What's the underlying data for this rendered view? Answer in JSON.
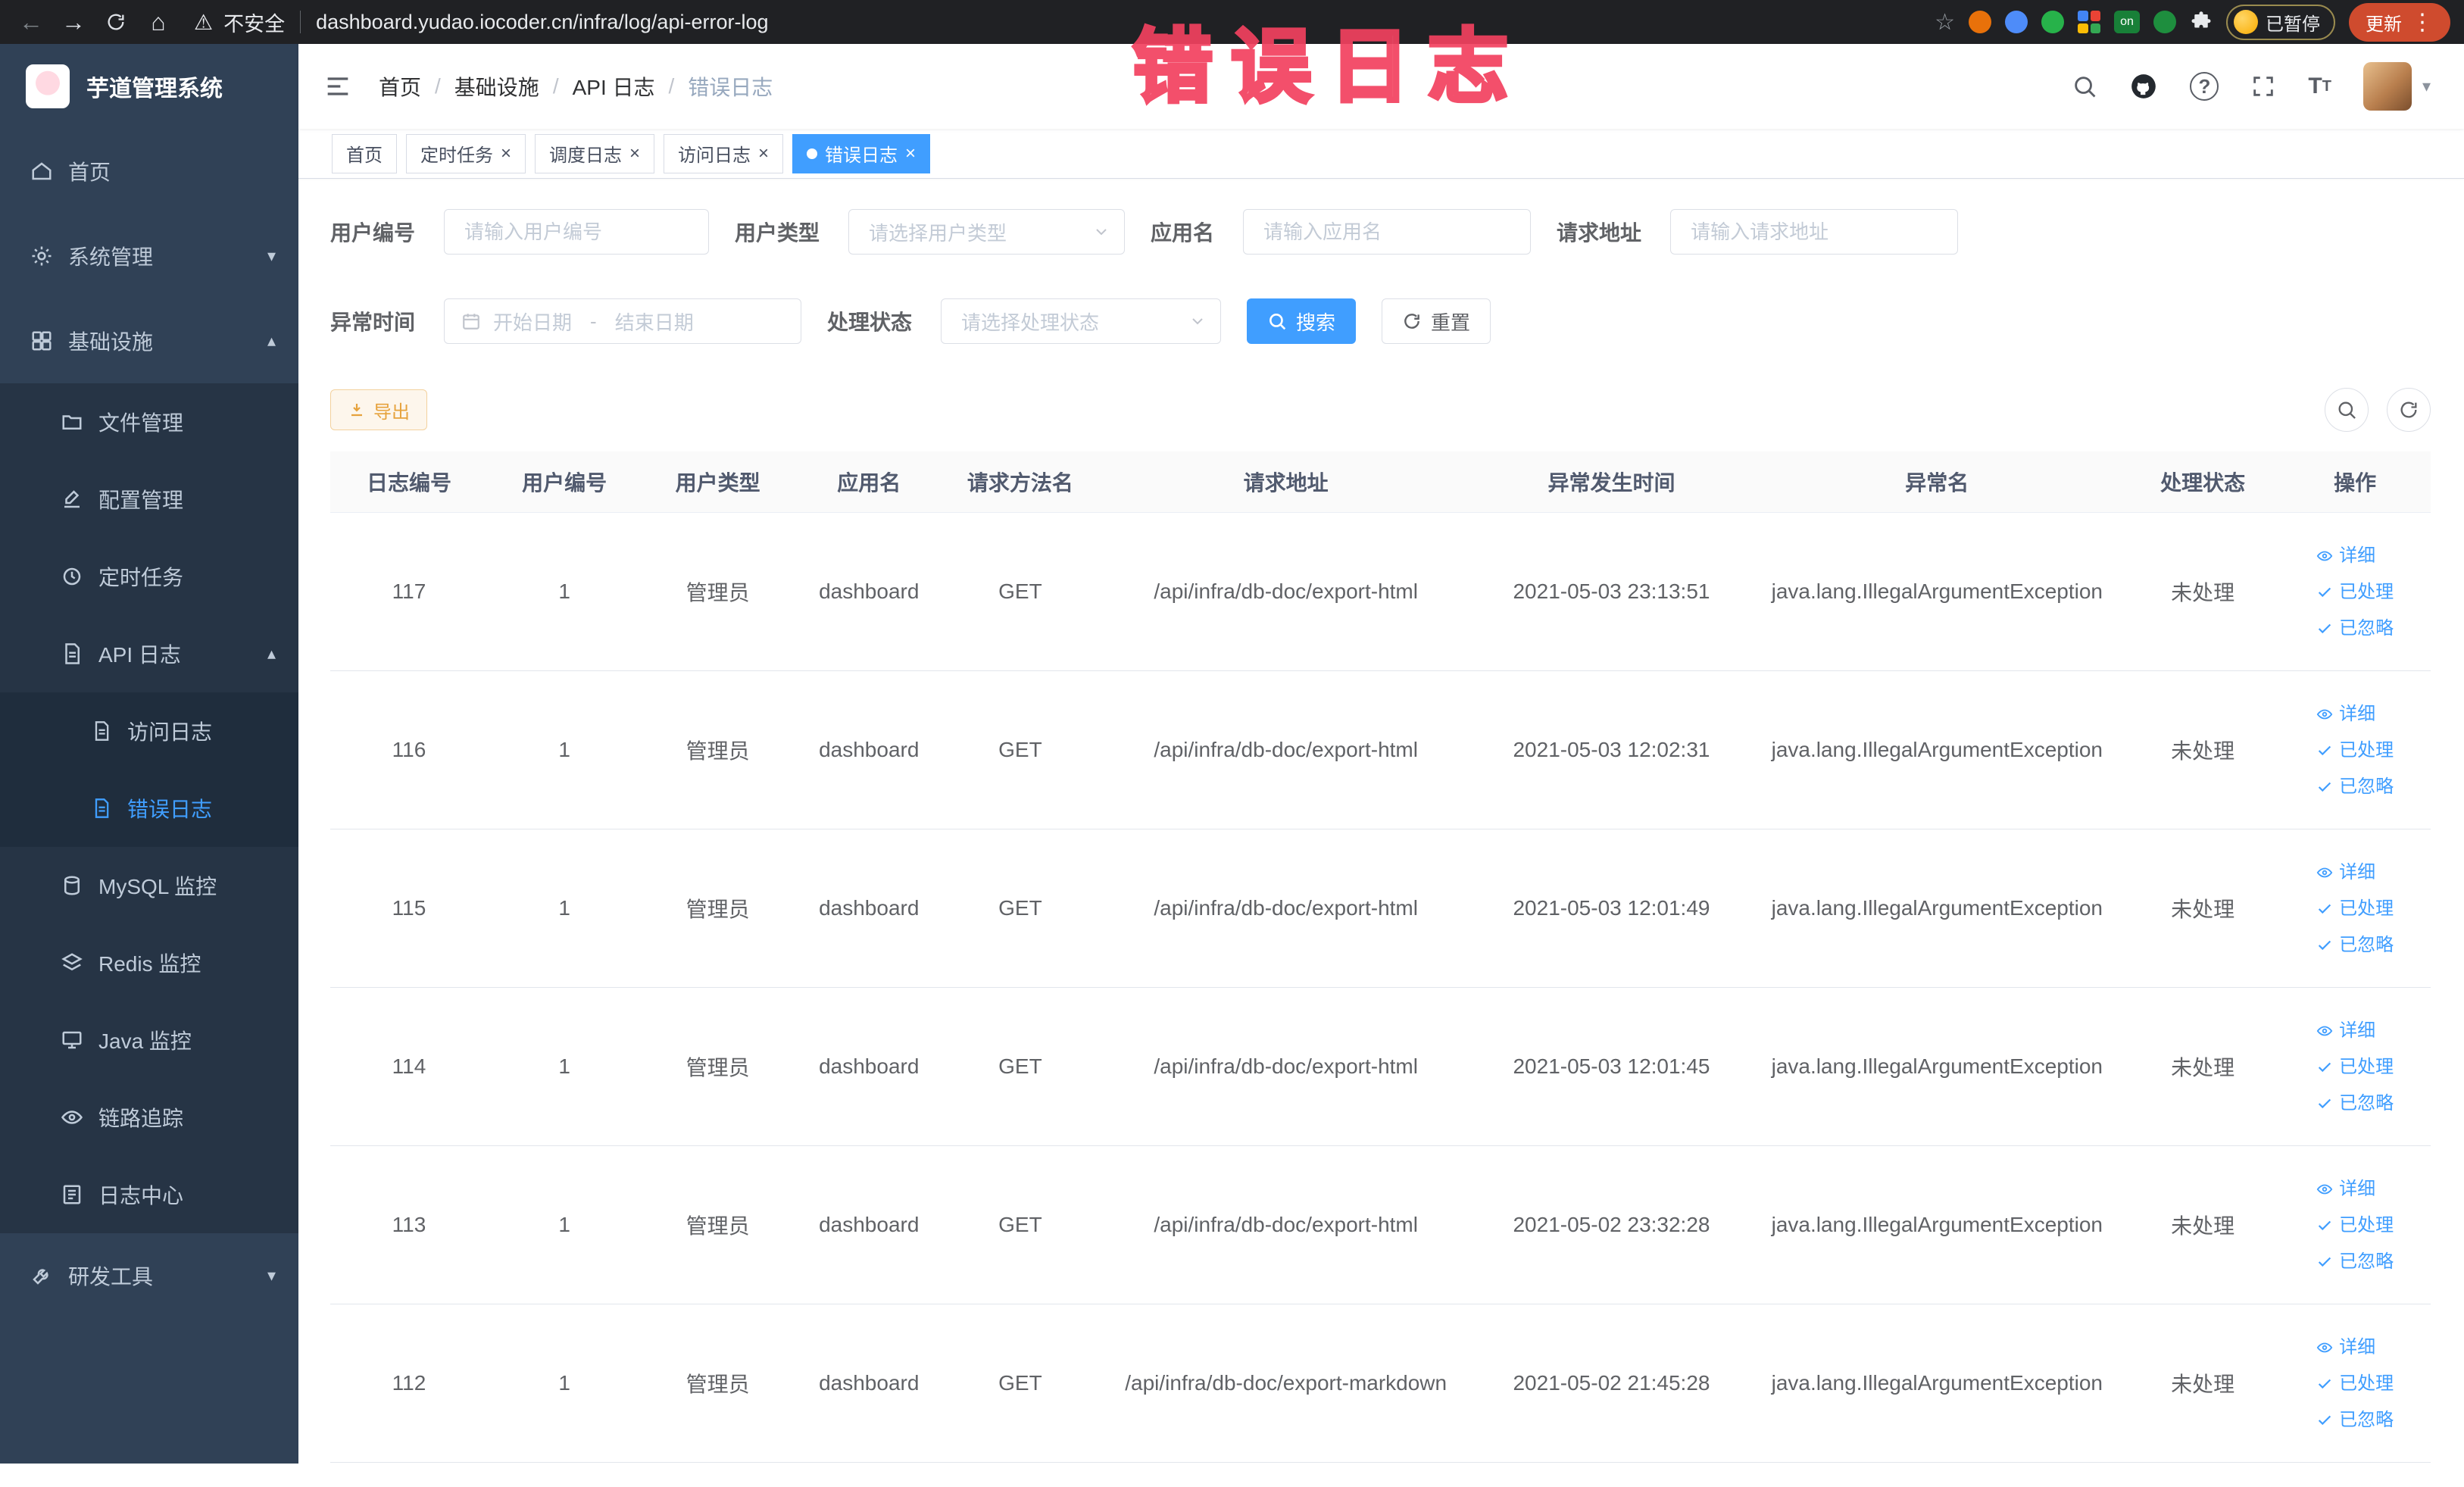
{
  "browser": {
    "security": "不安全",
    "url": "dashboard.yudao.iocoder.cn/infra/log/api-error-log",
    "paused_badge": "已暂停",
    "update_button": "更新",
    "extension_on_badge": "on"
  },
  "overlay": {
    "text": "错误日志"
  },
  "sidebar": {
    "logo_title": "芋道管理系统",
    "home": "首页",
    "system": "系统管理",
    "infra": "基础设施",
    "file": "文件管理",
    "config": "配置管理",
    "job": "定时任务",
    "api_log": "API 日志",
    "access_log": "访问日志",
    "error_log": "错误日志",
    "mysql": "MySQL 监控",
    "redis": "Redis 监控",
    "java": "Java 监控",
    "trace": "链路追踪",
    "log_center": "日志中心",
    "dev_tools": "研发工具"
  },
  "breadcrumb": {
    "items": [
      "首页",
      "基础设施",
      "API 日志",
      "错误日志"
    ]
  },
  "tags": {
    "home": "首页",
    "job": "定时任务",
    "schedule_log": "调度日志",
    "access_log": "访问日志",
    "error_log": "错误日志"
  },
  "filters": {
    "user_id_label": "用户编号",
    "user_id_placeholder": "请输入用户编号",
    "user_type_label": "用户类型",
    "user_type_placeholder": "请选择用户类型",
    "app_name_label": "应用名",
    "app_name_placeholder": "请输入应用名",
    "request_url_label": "请求地址",
    "request_url_placeholder": "请输入请求地址",
    "exception_time_label": "异常时间",
    "date_start_placeholder": "开始日期",
    "date_separator": "-",
    "date_end_placeholder": "结束日期",
    "process_status_label": "处理状态",
    "process_status_placeholder": "请选择处理状态",
    "search_button": "搜索",
    "reset_button": "重置"
  },
  "toolbar": {
    "export_button": "导出"
  },
  "table": {
    "columns": [
      "日志编号",
      "用户编号",
      "用户类型",
      "应用名",
      "请求方法名",
      "请求地址",
      "异常发生时间",
      "异常名",
      "处理状态",
      "操作"
    ],
    "action_labels": [
      "详细",
      "已处理",
      "已忽略"
    ],
    "rows": [
      [
        "117",
        "1",
        "管理员",
        "dashboard",
        "GET",
        "/api/infra/db-doc/export-html",
        "2021-05-03 23:13:51",
        "java.lang.IllegalArgumentException",
        "未处理"
      ],
      [
        "116",
        "1",
        "管理员",
        "dashboard",
        "GET",
        "/api/infra/db-doc/export-html",
        "2021-05-03 12:02:31",
        "java.lang.IllegalArgumentException",
        "未处理"
      ],
      [
        "115",
        "1",
        "管理员",
        "dashboard",
        "GET",
        "/api/infra/db-doc/export-html",
        "2021-05-03 12:01:49",
        "java.lang.IllegalArgumentException",
        "未处理"
      ],
      [
        "114",
        "1",
        "管理员",
        "dashboard",
        "GET",
        "/api/infra/db-doc/export-html",
        "2021-05-03 12:01:45",
        "java.lang.IllegalArgumentException",
        "未处理"
      ],
      [
        "113",
        "1",
        "管理员",
        "dashboard",
        "GET",
        "/api/infra/db-doc/export-html",
        "2021-05-02 23:32:28",
        "java.lang.IllegalArgumentException",
        "未处理"
      ],
      [
        "112",
        "1",
        "管理员",
        "dashboard",
        "GET",
        "/api/infra/db-doc/export-markdown",
        "2021-05-02 21:45:28",
        "java.lang.IllegalArgumentException",
        "未处理"
      ]
    ]
  }
}
